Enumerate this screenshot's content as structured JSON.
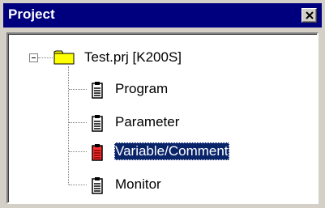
{
  "window": {
    "title": "Project",
    "close_label": "Close"
  },
  "tree": {
    "root": {
      "label": "Test.prj  [K200S]",
      "expanded": true,
      "icon": "folder-icon"
    },
    "children": [
      {
        "label": "Program",
        "icon": "document-icon",
        "selected": false
      },
      {
        "label": "Parameter",
        "icon": "document-icon",
        "selected": false
      },
      {
        "label": "Variable/Comment",
        "icon": "document-icon-red",
        "selected": true
      },
      {
        "label": "Monitor",
        "icon": "document-icon",
        "selected": false
      }
    ]
  },
  "colors": {
    "title_bar": "#00007f",
    "selection": "#0a246a",
    "folder": "#ffff00",
    "highlight_icon": "#ff0000"
  }
}
